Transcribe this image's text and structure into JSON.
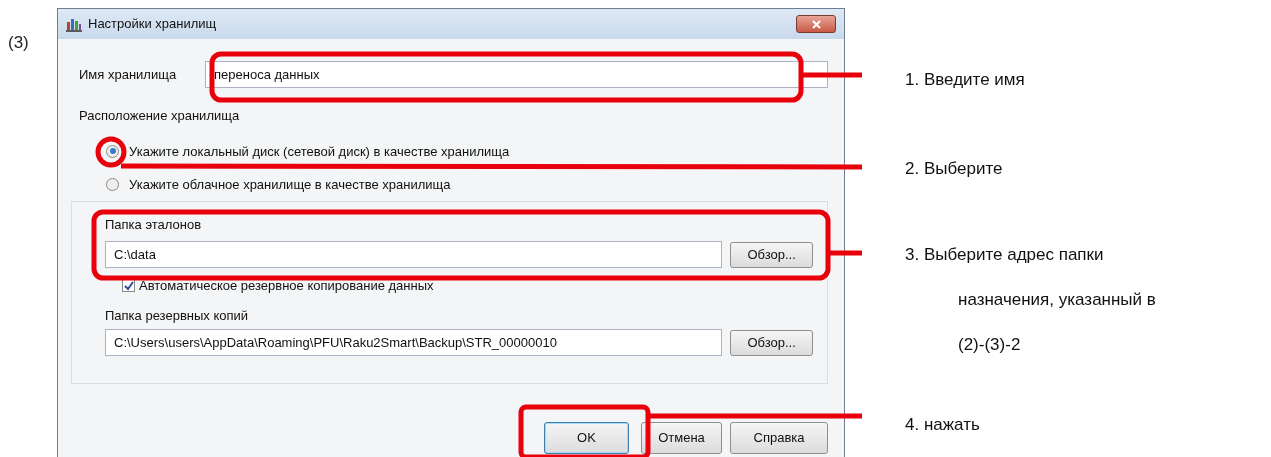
{
  "step_label": "(3)",
  "window": {
    "title": "Настройки хранилищ"
  },
  "name_field": {
    "label": "Имя хранилища",
    "value": "переноса данных"
  },
  "location": {
    "label": "Расположение хранилища",
    "options": [
      {
        "label": "Укажите локальный диск (сетевой диск) в качестве хранилища",
        "selected": true
      },
      {
        "label": "Укажите облачное хранилище в качестве хранилища",
        "selected": false
      }
    ]
  },
  "reference_folder": {
    "label": "Папка эталонов",
    "value": "C:\\data",
    "button": "Обзор..."
  },
  "auto_backup": {
    "label": "Автоматическое резервное копирование данных",
    "checked": true
  },
  "backup_folder": {
    "label": "Папка резервных копий",
    "value": "C:\\Users\\users\\AppData\\Roaming\\PFU\\Raku2Smart\\Backup\\STR_00000010",
    "button": "Обзор..."
  },
  "buttons": [
    {
      "label": "OK",
      "default": true
    },
    {
      "label": "Отмена",
      "default": false
    },
    {
      "label": "Справка",
      "default": false
    }
  ],
  "callouts": [
    {
      "lines": [
        "1. Введите имя"
      ]
    },
    {
      "lines": [
        "2. Выберите"
      ]
    },
    {
      "lines": [
        "3. Выберите адрес папки",
        "назначения, указанный в",
        "(2)-(3)-2"
      ]
    },
    {
      "lines": [
        "4. нажать"
      ]
    }
  ]
}
